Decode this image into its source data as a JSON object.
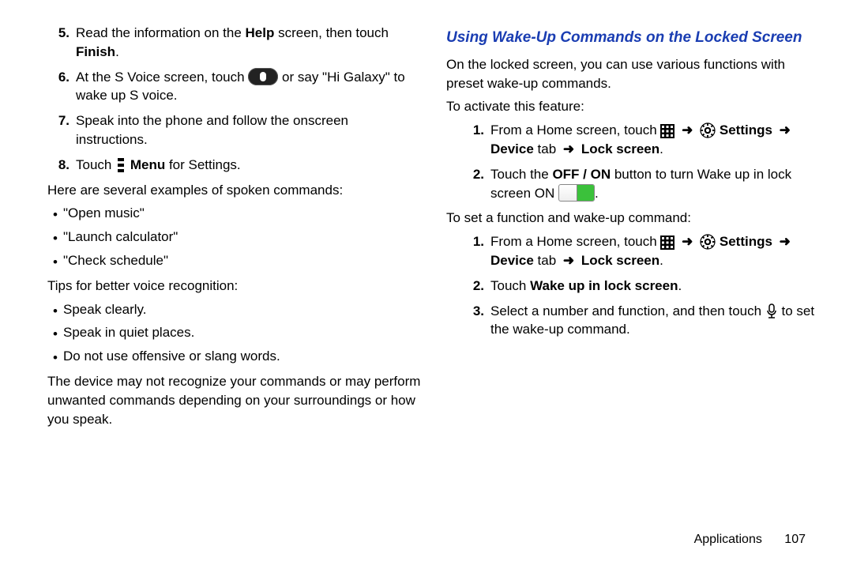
{
  "left": {
    "step5_a": "Read the information on the ",
    "step5_b": "Help",
    "step5_c": " screen, then touch ",
    "step5_d": "Finish",
    "step5_e": ".",
    "step6_a": "At the S Voice screen, touch ",
    "step6_b": " or say \"Hi Galaxy\" to wake up S voice.",
    "step7": "Speak into the phone and follow the onscreen instructions.",
    "step8_a": "Touch ",
    "step8_b": "Menu",
    "step8_c": " for Settings.",
    "examples_intro": "Here are several examples of spoken commands:",
    "ex1": "\"Open music\"",
    "ex2": "\"Launch calculator\"",
    "ex3": "\"Check schedule\"",
    "tips_intro": "Tips for better voice recognition:",
    "tip1": "Speak clearly.",
    "tip2": "Speak in quiet places.",
    "tip3": "Do not use offensive or slang words.",
    "note": "The device may not recognize your commands or may perform unwanted commands depending on your surroundings or how you speak."
  },
  "right": {
    "heading": "Using Wake-Up Commands on the Locked Screen",
    "intro": "On the locked screen, you can use various functions with preset wake-up commands.",
    "activate_intro": "To activate this feature:",
    "a1_a": "From a Home screen, touch ",
    "a1_settings": "Settings",
    "a1_device": "Device",
    "a1_tab": " tab ",
    "a1_lock": "Lock screen",
    "a1_dot": ".",
    "a2_a": "Touch the ",
    "a2_b": "OFF / ON",
    "a2_c": " button to turn Wake up in lock screen ON ",
    "a2_d": ".",
    "set_intro": "To set a function and wake-up command:",
    "s1_a": "From a Home screen, touch ",
    "s1_settings": "Settings",
    "s1_device": "Device",
    "s1_tab": " tab ",
    "s1_lock": "Lock screen",
    "s1_dot": ".",
    "s2_a": "Touch ",
    "s2_b": "Wake up in lock screen",
    "s2_c": ".",
    "s3_a": "Select a number and function, and then touch ",
    "s3_b": " to set the wake-up command."
  },
  "nums": {
    "n5": "5.",
    "n6": "6.",
    "n7": "7.",
    "n8": "8.",
    "n1": "1.",
    "n2": "2.",
    "n3": "3."
  },
  "footer": {
    "section": "Applications",
    "page": "107"
  },
  "arrow": "➜"
}
